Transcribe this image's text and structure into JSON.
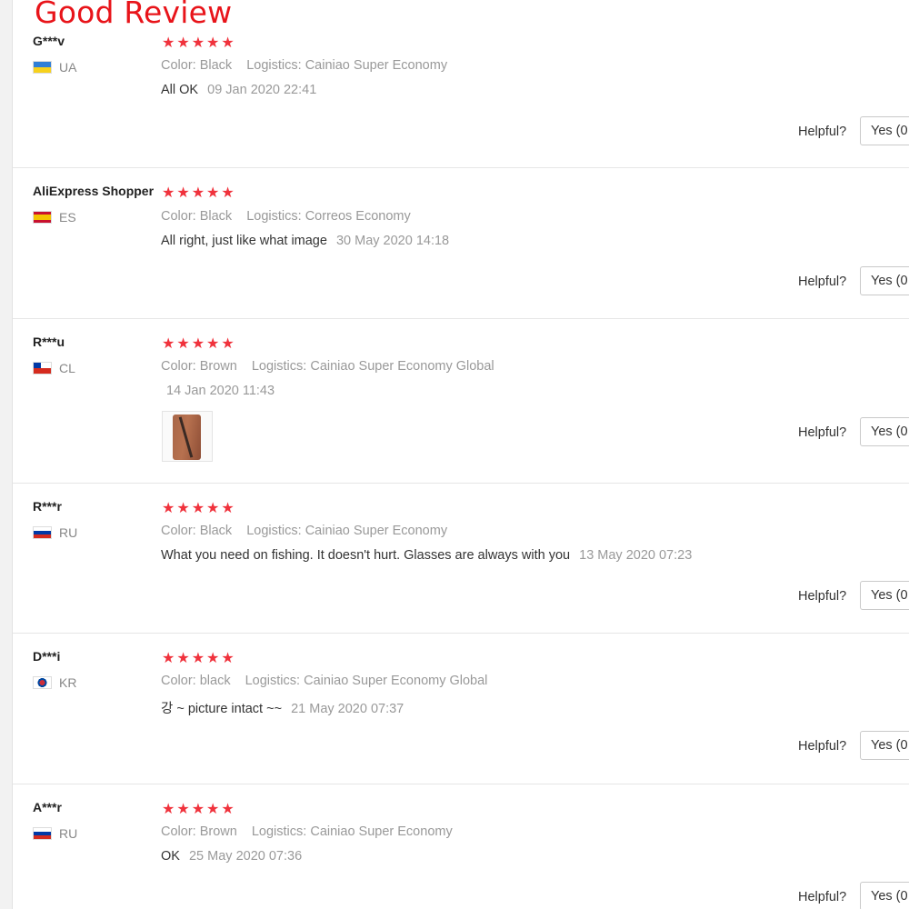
{
  "banner": {
    "title": "Good Review"
  },
  "colors": {
    "accent": "#e8141a",
    "star": "#f0323c",
    "muted": "#999999"
  },
  "labels": {
    "color": "Color:",
    "logistics": "Logistics:",
    "helpful": "Helpful?",
    "yes": "Yes (0"
  },
  "reviews": [
    {
      "user": "G***v",
      "country": "UA",
      "stars": 5,
      "color": "Black",
      "logistics": "Cainiao Super Economy",
      "text": "All OK",
      "date": "09 Jan 2020 22:41"
    },
    {
      "user": "AliExpress Shopper",
      "country": "ES",
      "stars": 5,
      "color": "Black",
      "logistics": "Correos Economy",
      "text": "All right, just like what image",
      "date": "30 May 2020 14:18"
    },
    {
      "user": "R***u",
      "country": "CL",
      "stars": 5,
      "color": "Brown",
      "logistics": "Cainiao Super Economy Global",
      "text": "",
      "date": "14 Jan 2020 11:43",
      "has_image": true
    },
    {
      "user": "R***r",
      "country": "RU",
      "stars": 5,
      "color": "Black",
      "logistics": "Cainiao Super Economy",
      "text": "What you need on fishing. It doesn't hurt. Glasses are always with you",
      "date": "13 May 2020 07:23"
    },
    {
      "user": "D***i",
      "country": "KR",
      "stars": 5,
      "color": "black",
      "logistics": "Cainiao Super Economy Global",
      "text": "강 ~ picture intact ~~",
      "date": "21 May 2020 07:37"
    },
    {
      "user": "A***r",
      "country": "RU",
      "stars": 5,
      "color": "Brown",
      "logistics": "Cainiao Super Economy",
      "text": "OK",
      "date": "25 May 2020 07:36"
    }
  ]
}
